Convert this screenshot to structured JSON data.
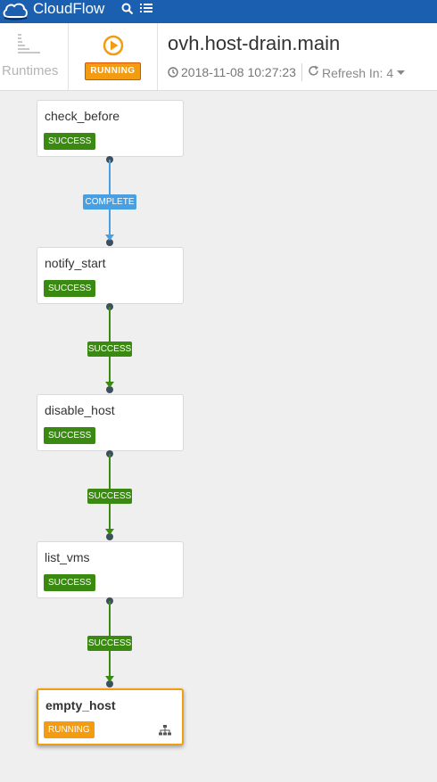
{
  "topbar": {
    "brand": "CloudFlow",
    "icons": [
      "cloud-logo",
      "search-icon",
      "list-icon"
    ]
  },
  "header": {
    "runtimes_label": "Runtimes",
    "status": "RUNNING",
    "workflow_title": "ovh.host-drain.main",
    "timestamp": "2018-11-08 10:27:23",
    "refresh_label": "Refresh In: 4"
  },
  "tasks": [
    {
      "name": "check_before",
      "status": "SUCCESS"
    },
    {
      "name": "notify_start",
      "status": "SUCCESS"
    },
    {
      "name": "disable_host",
      "status": "SUCCESS"
    },
    {
      "name": "list_vms",
      "status": "SUCCESS"
    },
    {
      "name": "empty_host",
      "status": "RUNNING"
    }
  ],
  "transitions": [
    {
      "label": "COMPLETE"
    },
    {
      "label": "SUCCESS"
    },
    {
      "label": "SUCCESS"
    },
    {
      "label": "SUCCESS"
    }
  ],
  "colors": {
    "topbar": "#1a5fb0",
    "success": "#3a8a12",
    "running": "#f39c12",
    "complete": "#4a9fe0"
  }
}
